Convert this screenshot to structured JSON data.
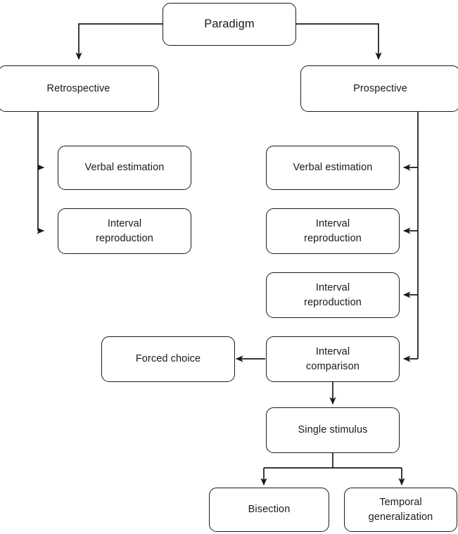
{
  "diagram": {
    "title": "Timing paradigm taxonomy flowchart",
    "stroke_color": "#1a1a1a",
    "fill_color": "#ffffff",
    "nodes": {
      "paradigm": "Paradigm",
      "retrospective": "Retrospective",
      "prospective": "Prospective",
      "retro_verbal_estimation": "Verbal estimation",
      "retro_interval_reproduction": "Interval\nreproduction",
      "pro_verbal_estimation": "Verbal estimation",
      "pro_interval_reproduction_1": "Interval\nreproduction",
      "pro_interval_reproduction_2": "Interval\nreproduction",
      "pro_interval_comparison": "Interval\ncomparison",
      "forced_choice": "Forced choice",
      "single_stimulus": "Single stimulus",
      "bisection": "Bisection",
      "temporal_generalization": "Temporal\ngeneralization"
    },
    "edges": [
      {
        "from": "paradigm",
        "to": "retrospective"
      },
      {
        "from": "paradigm",
        "to": "prospective"
      },
      {
        "from": "retrospective",
        "to": "retro_verbal_estimation"
      },
      {
        "from": "retrospective",
        "to": "retro_interval_reproduction"
      },
      {
        "from": "prospective",
        "to": "pro_verbal_estimation"
      },
      {
        "from": "prospective",
        "to": "pro_interval_reproduction_1"
      },
      {
        "from": "prospective",
        "to": "pro_interval_reproduction_2"
      },
      {
        "from": "prospective",
        "to": "pro_interval_comparison"
      },
      {
        "from": "pro_interval_comparison",
        "to": "forced_choice"
      },
      {
        "from": "pro_interval_comparison",
        "to": "single_stimulus"
      },
      {
        "from": "single_stimulus",
        "to": "bisection"
      },
      {
        "from": "single_stimulus",
        "to": "temporal_generalization"
      }
    ]
  }
}
